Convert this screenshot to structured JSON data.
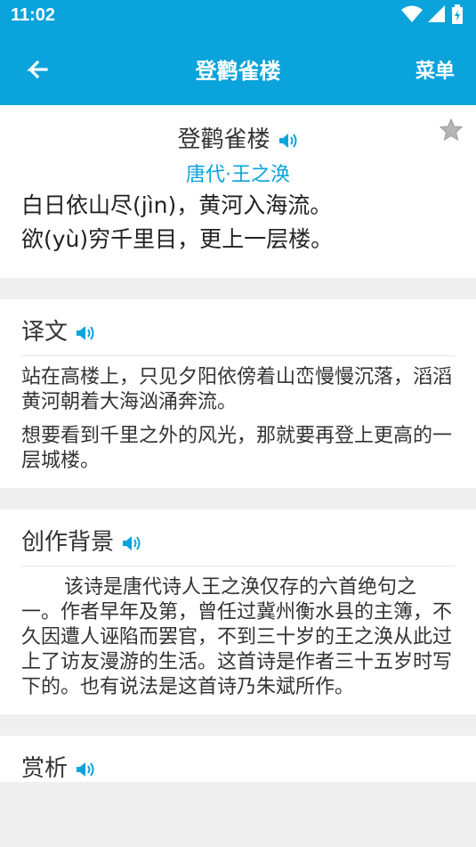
{
  "status_bar": {
    "time": "11:02"
  },
  "app_bar": {
    "title": "登鹳雀楼",
    "menu_label": "菜单"
  },
  "poem": {
    "title": "登鹳雀楼",
    "dynasty_author": "唐代·王之涣",
    "lines": [
      "白日依山尽(jìn)，黄河入海流。",
      "欲(yù)穷千里目，更上一层楼。"
    ]
  },
  "translation": {
    "heading": "译文",
    "paragraphs": [
      "站在高楼上，只见夕阳依傍着山峦慢慢沉落，滔滔黄河朝着大海汹涌奔流。",
      "想要看到千里之外的风光，那就要再登上更高的一层城楼。"
    ]
  },
  "background": {
    "heading": "创作背景",
    "paragraph": "该诗是唐代诗人王之涣仅存的六首绝句之一。作者早年及第，曾任过冀州衡水县的主簿，不久因遭人诬陷而罢官，不到三十岁的王之涣从此过上了访友漫游的生活。这首诗是作者三十五岁时写下的。也有说法是这首诗乃朱斌所作。"
  },
  "appreciation": {
    "heading": "赏析"
  },
  "colors": {
    "accent": "#0aa3dc",
    "background": "#efefef"
  },
  "icons": [
    "back-arrow-icon",
    "speaker-icon",
    "star-icon",
    "wifi-icon",
    "signal-icon",
    "battery-icon"
  ]
}
